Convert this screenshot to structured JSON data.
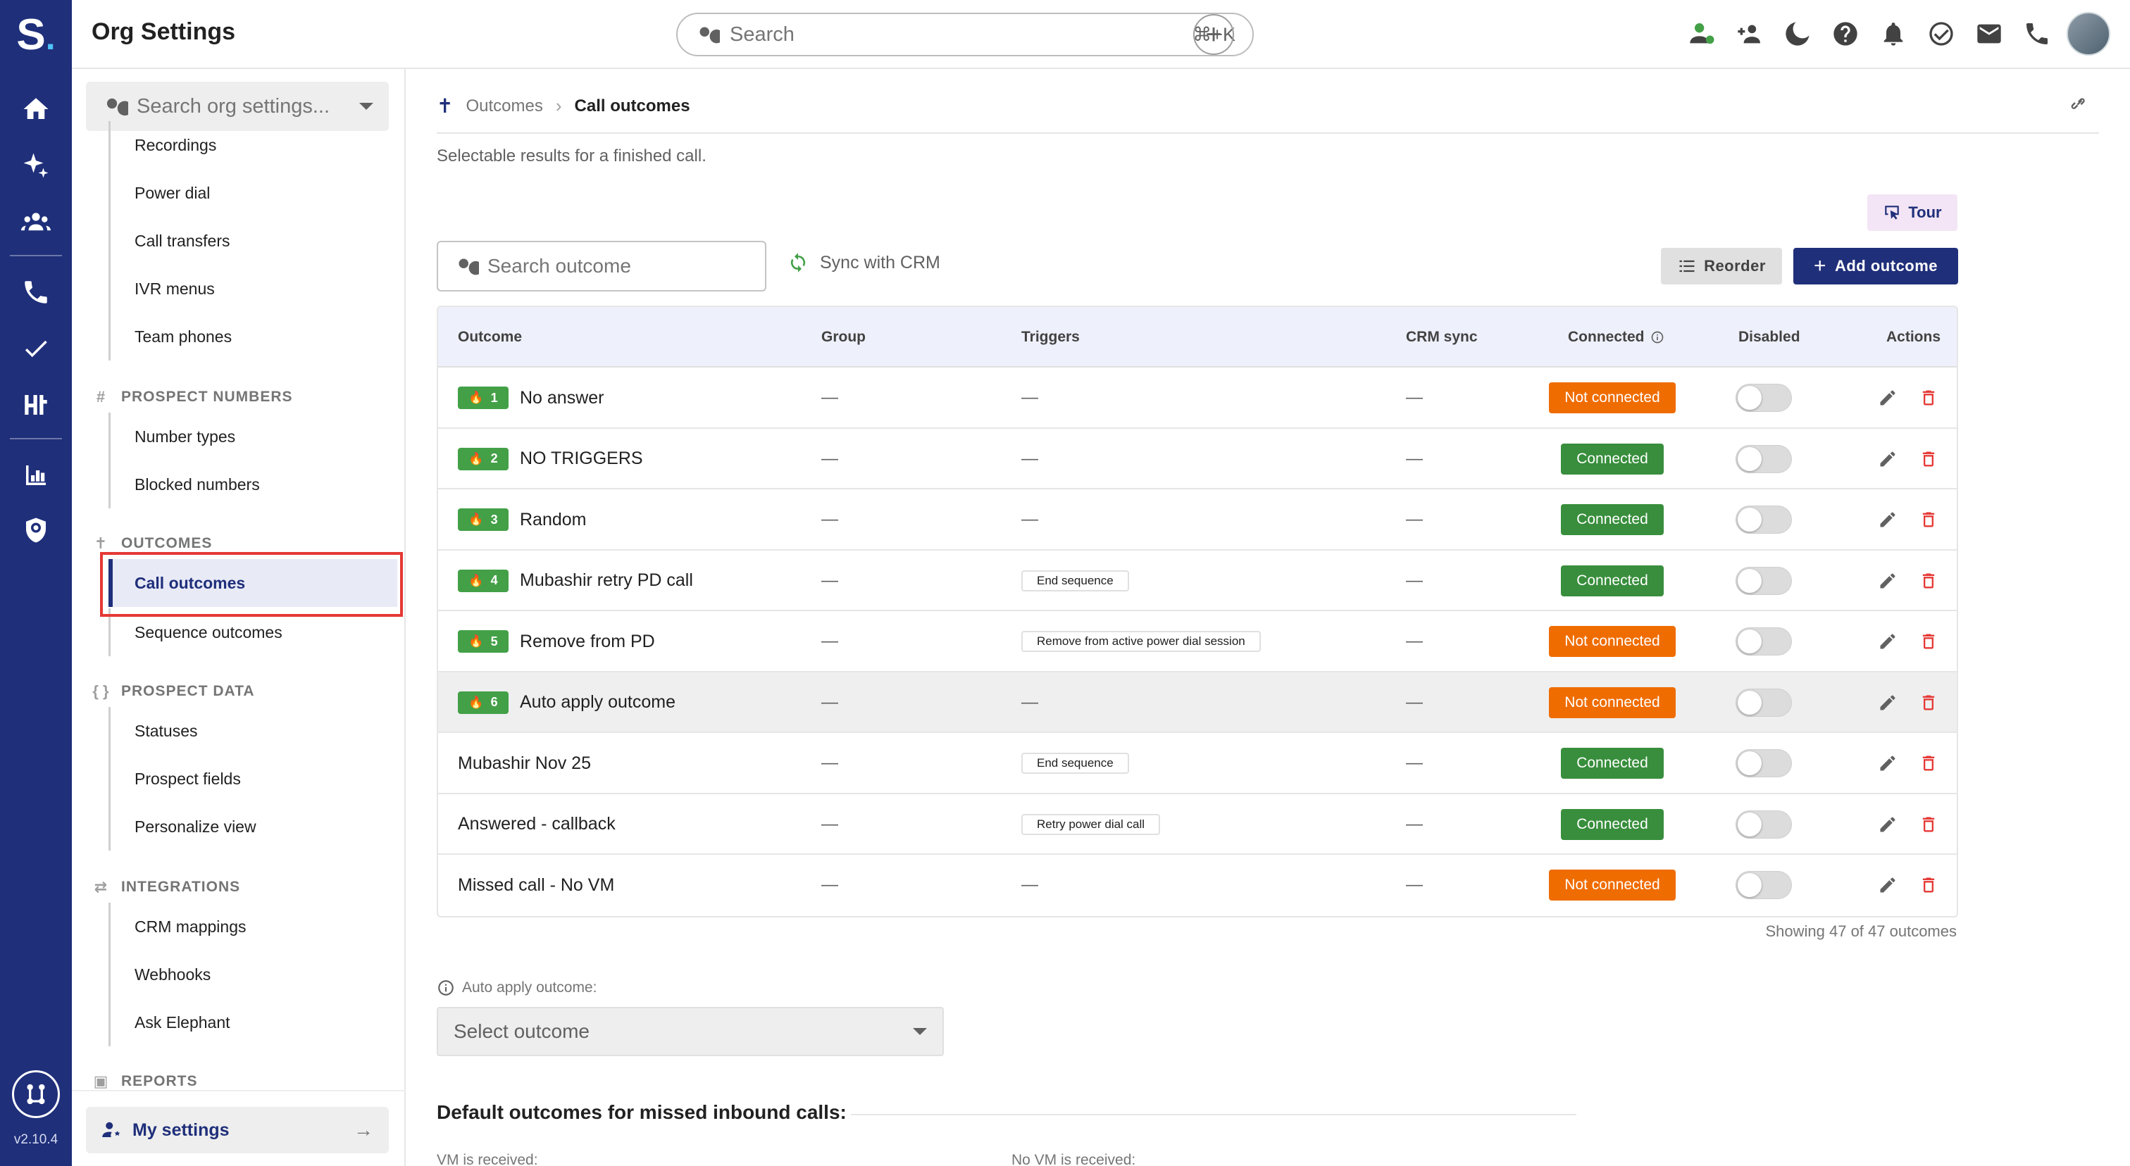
{
  "app": {
    "title": "Org Settings",
    "version": "v2.10.4",
    "logo_letter": "S",
    "logo_dot": "."
  },
  "topbar": {
    "search_placeholder": "Search",
    "search_shortcut": "⌘+K",
    "icons": [
      "person-status-icon",
      "add-team-icon",
      "do-not-disturb-icon",
      "help-icon",
      "notifications-icon",
      "tasks-icon",
      "mail-icon",
      "phone-icon"
    ]
  },
  "rail": {
    "icons": [
      "home-icon",
      "ai-sparkle-icon",
      "team-icon",
      "phone-icon",
      "tasks-icon",
      "hubs-icon",
      "analytics-icon",
      "shield-icon",
      "integrations-circle-icon"
    ]
  },
  "sidebar": {
    "search_placeholder": "Search org settings...",
    "items_top": [
      "Recordings",
      "Power dial",
      "Call transfers",
      "IVR menus",
      "Team phones"
    ],
    "sections": [
      {
        "icon": "#",
        "label": "PROSPECT NUMBERS",
        "items": [
          "Number types",
          "Blocked numbers"
        ]
      },
      {
        "icon": "✝",
        "label": "OUTCOMES",
        "items": [
          "Call outcomes",
          "Sequence outcomes"
        ]
      },
      {
        "icon": "{ }",
        "label": "PROSPECT DATA",
        "items": [
          "Statuses",
          "Prospect fields",
          "Personalize view"
        ]
      },
      {
        "icon": "⇄",
        "label": "INTEGRATIONS",
        "items": [
          "CRM mappings",
          "Webhooks",
          "Ask Elephant"
        ]
      },
      {
        "icon": "▣",
        "label": "REPORTS",
        "items": []
      }
    ],
    "active_item": "Call outcomes",
    "my_settings": "My settings"
  },
  "breadcrumb": {
    "parent": "Outcomes",
    "current": "Call outcomes"
  },
  "main": {
    "description": "Selectable results for a finished call.",
    "tour_label": "Tour",
    "search_outcome_placeholder": "Search outcome",
    "sync_label": "Sync with CRM",
    "reorder_label": "Reorder",
    "add_outcome_label": "Add outcome",
    "showing_text": "Showing 47 of 47 outcomes",
    "auto_apply_label": "Auto apply outcome:",
    "select_outcome_placeholder": "Select outcome",
    "default_heading": "Default outcomes for missed inbound calls:",
    "vm_label": "VM is received:",
    "novm_label": "No VM is received:"
  },
  "table": {
    "columns": [
      "Outcome",
      "Group",
      "Triggers",
      "CRM sync",
      "Connected",
      "Disabled",
      "Actions"
    ],
    "rows": [
      {
        "rank": "1",
        "name": "No answer",
        "group": "—",
        "trigger": "—",
        "crm": "—",
        "connected": "Not connected",
        "status": "off",
        "disabled": false,
        "shaded": false
      },
      {
        "rank": "2",
        "name": "NO TRIGGERS",
        "group": "—",
        "trigger": "—",
        "crm": "—",
        "connected": "Connected",
        "status": "on",
        "disabled": false,
        "shaded": false
      },
      {
        "rank": "3",
        "name": "Random",
        "group": "—",
        "trigger": "—",
        "crm": "—",
        "connected": "Connected",
        "status": "on",
        "disabled": false,
        "shaded": false
      },
      {
        "rank": "4",
        "name": "Mubashir retry PD call",
        "group": "—",
        "trigger": "End sequence",
        "crm": "—",
        "connected": "Connected",
        "status": "on",
        "disabled": false,
        "shaded": false
      },
      {
        "rank": "5",
        "name": "Remove from PD",
        "group": "—",
        "trigger": "Remove from active power dial session",
        "crm": "—",
        "connected": "Not connected",
        "status": "off",
        "disabled": false,
        "shaded": false
      },
      {
        "rank": "6",
        "name": "Auto apply outcome",
        "group": "—",
        "trigger": "—",
        "crm": "—",
        "connected": "Not connected",
        "status": "off",
        "disabled": false,
        "shaded": true
      },
      {
        "rank": "",
        "name": "Mubashir Nov 25",
        "group": "—",
        "trigger": "End sequence",
        "crm": "—",
        "connected": "Connected",
        "status": "on",
        "disabled": false,
        "shaded": false
      },
      {
        "rank": "",
        "name": "Answered - callback",
        "group": "—",
        "trigger": "Retry power dial call",
        "crm": "—",
        "connected": "Connected",
        "status": "on",
        "disabled": false,
        "shaded": false
      },
      {
        "rank": "",
        "name": "Missed call - No VM",
        "group": "—",
        "trigger": "—",
        "crm": "—",
        "connected": "Not connected",
        "status": "off",
        "disabled": false,
        "shaded": false
      }
    ]
  },
  "colors": {
    "brand": "#1f2f7a",
    "connected": "#388e3c",
    "not_connected": "#ef6c00",
    "rank_badge": "#43a047",
    "delete": "#e53935",
    "highlight": "#e53935"
  }
}
